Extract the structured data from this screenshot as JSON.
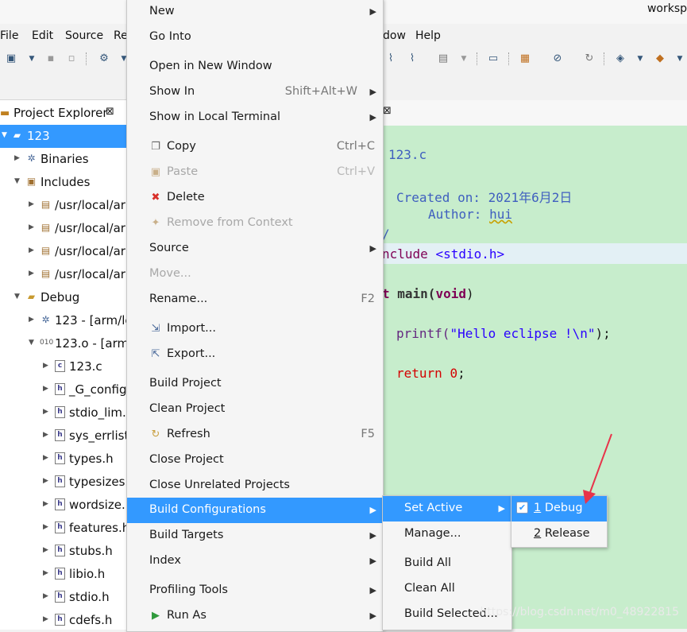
{
  "window": {
    "title_fragment": "worksp"
  },
  "menubar": [
    "File",
    "Edit",
    "Source",
    "Re",
    "dow",
    "Help"
  ],
  "explorer": {
    "title": "Project Explorer",
    "items": [
      {
        "label": "123",
        "icon": "project-folder-icon"
      },
      {
        "label": "Binaries",
        "icon": "binaries-icon"
      },
      {
        "label": "Includes",
        "icon": "includes-icon"
      },
      {
        "label": "/usr/local/arr",
        "icon": "include-folder-icon"
      },
      {
        "label": "/usr/local/arr",
        "icon": "include-folder-icon"
      },
      {
        "label": "/usr/local/arr",
        "icon": "include-folder-icon"
      },
      {
        "label": "/usr/local/arr",
        "icon": "include-folder-icon"
      },
      {
        "label": "Debug",
        "icon": "folder-icon"
      },
      {
        "label": "123 - [arm/le]",
        "icon": "binary-icon"
      },
      {
        "label": "123.o - [arm/l",
        "icon": "object-file-icon"
      },
      {
        "label": "123.c",
        "icon": "c-file-icon"
      },
      {
        "label": "_G_config.",
        "icon": "header-file-icon"
      },
      {
        "label": "stdio_lim.h",
        "icon": "header-file-icon"
      },
      {
        "label": "sys_errlist",
        "icon": "header-file-icon"
      },
      {
        "label": "types.h",
        "icon": "header-file-icon"
      },
      {
        "label": "typesizes.h",
        "icon": "header-file-icon"
      },
      {
        "label": "wordsize.h",
        "icon": "header-file-icon"
      },
      {
        "label": "features.h",
        "icon": "header-file-icon"
      },
      {
        "label": "stubs.h",
        "icon": "header-file-icon"
      },
      {
        "label": "libio.h",
        "icon": "header-file-icon"
      },
      {
        "label": "stdio.h",
        "icon": "header-file-icon"
      },
      {
        "label": "cdefs.h",
        "icon": "header-file-icon"
      }
    ]
  },
  "editor": {
    "lines": {
      "l1": "123.c",
      "l2a": "Created on: ",
      "l2b": "2021年6月2日",
      "l3a": "Author: ",
      "l3b": "hui",
      "l4": "/",
      "l5a": "nclude ",
      "l5b": "<stdio.h>",
      "l6a": "t ",
      "l6b": "main(",
      "l6c": "void",
      "l6d": ")",
      "l7a": "printf(",
      "l7b": "\"Hello eclipse !\\n\"",
      "l7c": ");",
      "l8a": "return ",
      "l8b": "0",
      "l8c": ";"
    },
    "colors": {
      "background": "#c7edcc",
      "keyword": "#7f0055",
      "string": "#2a00ff",
      "comment": "#3f5fbf"
    }
  },
  "context_menu": {
    "items": [
      {
        "label": "New",
        "submenu": true
      },
      {
        "label": "Go Into"
      },
      {
        "label": "Open in New Window"
      },
      {
        "label": "Show In",
        "accel": "Shift+Alt+W",
        "submenu": true
      },
      {
        "label": "Show in Local Terminal",
        "submenu": true
      },
      {
        "label": "Copy",
        "accel": "Ctrl+C",
        "icon": "copy-icon"
      },
      {
        "label": "Paste",
        "accel": "Ctrl+V",
        "icon": "paste-icon",
        "disabled": true
      },
      {
        "label": "Delete",
        "icon": "delete-icon"
      },
      {
        "label": "Remove from Context",
        "icon": "remove-context-icon",
        "disabled": true
      },
      {
        "label": "Source",
        "submenu": true
      },
      {
        "label": "Move...",
        "disabled": true
      },
      {
        "label": "Rename...",
        "accel": "F2"
      },
      {
        "label": "Import...",
        "icon": "import-icon"
      },
      {
        "label": "Export...",
        "icon": "export-icon"
      },
      {
        "label": "Build Project"
      },
      {
        "label": "Clean Project"
      },
      {
        "label": "Refresh",
        "accel": "F5",
        "icon": "refresh-icon"
      },
      {
        "label": "Close Project"
      },
      {
        "label": "Close Unrelated Projects"
      },
      {
        "label": "Build Configurations",
        "submenu": true,
        "highlighted": true
      },
      {
        "label": "Build Targets",
        "submenu": true
      },
      {
        "label": "Index",
        "submenu": true
      },
      {
        "label": "Profiling Tools",
        "submenu": true
      },
      {
        "label": "Run As",
        "submenu": true,
        "icon": "run-icon"
      }
    ]
  },
  "build_config_submenu": {
    "items": [
      {
        "label": "Set Active",
        "submenu": true,
        "highlighted": true
      },
      {
        "label": "Manage..."
      },
      {
        "label": "Build All"
      },
      {
        "label": "Clean All"
      },
      {
        "label": "Build Selected..."
      }
    ]
  },
  "set_active_submenu": {
    "items": [
      {
        "mnemonic": "1",
        "label": " Debug",
        "checked": true,
        "highlighted": true
      },
      {
        "mnemonic": "2",
        "label": " Release"
      }
    ]
  },
  "watermark": "https://blog.csdn.net/m0_48922815",
  "accent_color": "#3399ff",
  "annotation_arrow_color": "#e8334a"
}
